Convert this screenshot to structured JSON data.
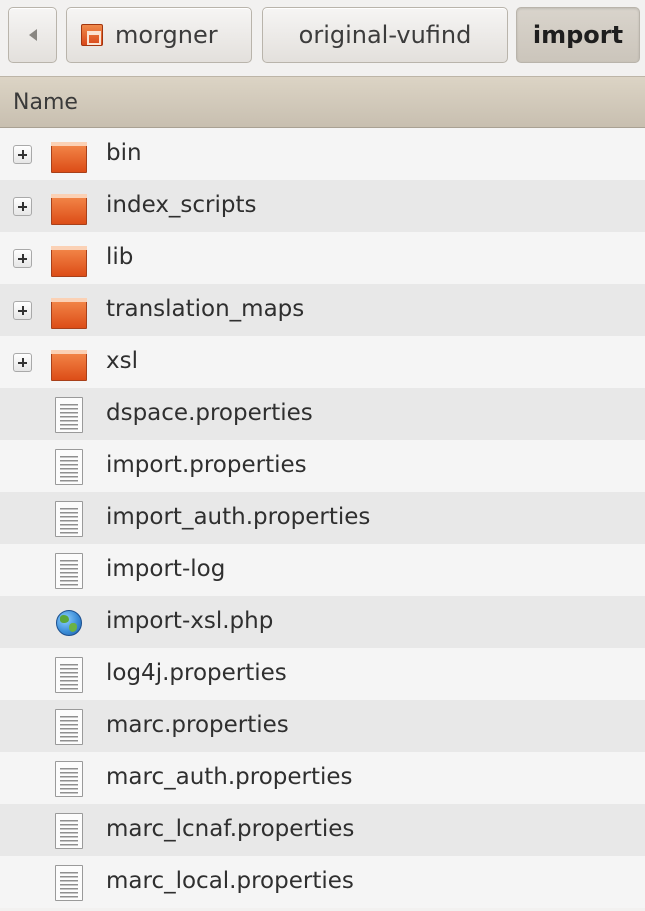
{
  "pathbar": {
    "home_label": "morgner",
    "crumb2_label": "original-vufind",
    "current_label": "import"
  },
  "columns": {
    "name_header": "Name"
  },
  "files": [
    {
      "name": "bin",
      "type": "folder",
      "icon": "folder-icon",
      "expandable": true
    },
    {
      "name": "index_scripts",
      "type": "folder",
      "icon": "folder-icon",
      "expandable": true
    },
    {
      "name": "lib",
      "type": "folder",
      "icon": "folder-icon",
      "expandable": true
    },
    {
      "name": "translation_maps",
      "type": "folder",
      "icon": "folder-icon",
      "expandable": true
    },
    {
      "name": "xsl",
      "type": "folder",
      "icon": "folder-icon",
      "expandable": true
    },
    {
      "name": "dspace.properties",
      "type": "file",
      "icon": "text-file-icon",
      "expandable": false
    },
    {
      "name": "import.properties",
      "type": "file",
      "icon": "text-file-icon",
      "expandable": false
    },
    {
      "name": "import_auth.properties",
      "type": "file",
      "icon": "text-file-icon",
      "expandable": false
    },
    {
      "name": "import-log",
      "type": "file",
      "icon": "text-file-icon",
      "expandable": false
    },
    {
      "name": "import-xsl.php",
      "type": "file",
      "icon": "globe-icon",
      "expandable": false
    },
    {
      "name": "log4j.properties",
      "type": "file",
      "icon": "text-file-icon",
      "expandable": false
    },
    {
      "name": "marc.properties",
      "type": "file",
      "icon": "text-file-icon",
      "expandable": false
    },
    {
      "name": "marc_auth.properties",
      "type": "file",
      "icon": "text-file-icon",
      "expandable": false
    },
    {
      "name": "marc_lcnaf.properties",
      "type": "file",
      "icon": "text-file-icon",
      "expandable": false
    },
    {
      "name": "marc_local.properties",
      "type": "file",
      "icon": "text-file-icon",
      "expandable": false
    }
  ]
}
